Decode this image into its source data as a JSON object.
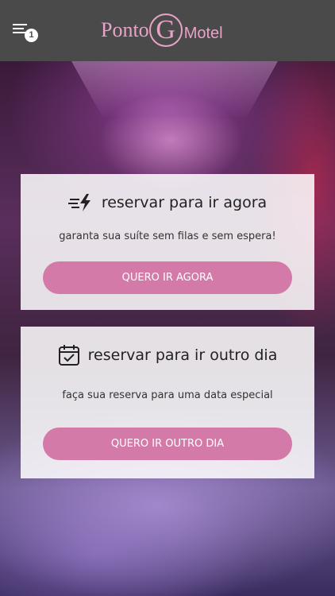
{
  "header": {
    "menu_icon": "menu-icon",
    "menu_badge": "1",
    "logo": {
      "part1": "Ponto",
      "mark": "G",
      "part2": "Motel",
      "color": "#e8a3c9"
    },
    "background": "#4a4a4a"
  },
  "cards": [
    {
      "icon": "bolt-speed-icon",
      "title": "reservar para ir agora",
      "subtitle": "garanta sua suíte sem filas e sem espera!",
      "button": "QUERO IR AGORA"
    },
    {
      "icon": "calendar-check-icon",
      "title": "reservar para ir outro dia",
      "subtitle": "faça sua reserva para uma data especial",
      "button": "QUERO IR OUTRO DIA"
    }
  ],
  "colors": {
    "accent": "#d47aa8",
    "card_bg": "#ffffff"
  }
}
